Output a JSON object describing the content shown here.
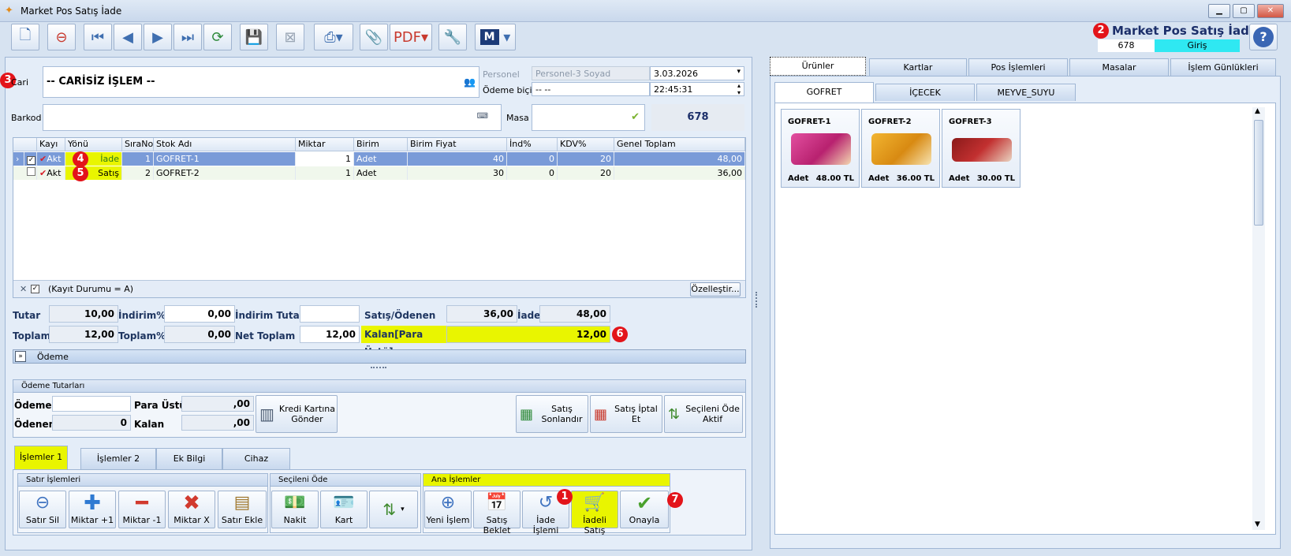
{
  "window": {
    "title": "Market Pos Satış İade"
  },
  "header": {
    "title": "Market Pos Satış İade",
    "number": "678",
    "mode": "Giriş"
  },
  "form": {
    "cari_label": "Cari",
    "cari_value": "-- CARİSİZ İŞLEM --",
    "personel_label": "Personel",
    "personel_value": "Personel-3 Soyad",
    "odeme_label": "Ödeme biçimi",
    "odeme_value": "-- --",
    "date": "3.03.2026",
    "time": "22:45:31",
    "barkod_label": "Barkod",
    "masa_label": "Masa",
    "masa_no": "678"
  },
  "grid": {
    "columns": [
      "Kayı",
      "Yönü",
      "SıraNo",
      "Stok Adı",
      "Miktar",
      "Birim",
      "Birim Fiyat",
      "İnd%",
      "KDV%",
      "Genel Toplam"
    ],
    "rows": [
      {
        "kayit": "Akt",
        "yonu": "İade",
        "sira": "1",
        "stok": "GOFRET-1",
        "miktar": "1",
        "birim": "Adet",
        "fiyat": "40",
        "ind": "0",
        "kdv": "20",
        "toplam": "48,00"
      },
      {
        "kayit": "Akt",
        "yonu": "Satış",
        "sira": "2",
        "stok": "GOFRET-2",
        "miktar": "1",
        "birim": "Adet",
        "fiyat": "30",
        "ind": "0",
        "kdv": "20",
        "toplam": "36,00"
      }
    ],
    "filter": "(Kayıt Durumu = A)",
    "customize": "Özelleştir..."
  },
  "totals": {
    "tutar_label": "Tutar",
    "tutar": "10,00",
    "toplam_label": "Toplam",
    "toplam": "12,00",
    "indirim_label": "İndirim%",
    "indirim": "0,00",
    "toplam_pct_label": "Toplam%",
    "toplam_pct": "0,00",
    "indirim_tutar_label": "İndirim Tutar",
    "indirim_tutar": "",
    "net_label": "Net Toplam",
    "net": "12,00",
    "satis_label": "Satış/Ödenen",
    "satis": "36,00",
    "iade_label": "İade",
    "iade": "48,00",
    "kalan_label": "Kalan[Para Üstü]",
    "kalan": "12,00"
  },
  "odeme_bar": "Ödeme",
  "odeme_tutarlari": {
    "title": "Ödeme Tutarları",
    "odeme_label": "Ödeme",
    "odeme": "",
    "odenen_label": "Ödenen",
    "odenen": "0",
    "para_ustu_label": "Para Üstü",
    "para_ustu": ",00",
    "kalan_label": "Kalan",
    "kalan": ",00",
    "kredi": "Kredi Kartına Gönder",
    "satis_sonlandir": "Satış Sonlandır",
    "satis_iptal": "Satış İptal Et",
    "secileni_ode": "Seçileni Öde Aktif"
  },
  "bottom_tabs": [
    "İşlemler 1",
    "İşlemler 2",
    "Ek Bilgi",
    "Cihaz"
  ],
  "groups": {
    "satir": {
      "title": "Satır İşlemleri",
      "buttons": [
        "Satır Sil",
        "Miktar +1",
        "Miktar -1",
        "Miktar X",
        "Satır Ekle"
      ]
    },
    "secileni": {
      "title": "Seçileni Öde",
      "buttons": [
        "Nakit",
        "Kart"
      ]
    },
    "ana": {
      "title": "Ana İşlemler",
      "buttons": [
        "Yeni İşlem",
        "Satış Beklet",
        "İade İşlemi",
        "İadeli Satış",
        "Onayla"
      ]
    }
  },
  "right_tabs": [
    "Ürünler",
    "Kartlar",
    "Pos İşlemleri",
    "Masalar",
    "İşlem Günlükleri"
  ],
  "category_tabs": [
    "GOFRET",
    "İÇECEK",
    "MEYVE_SUYU"
  ],
  "products": [
    {
      "name": "GOFRET-1",
      "unit": "Adet",
      "price": "48.00 TL"
    },
    {
      "name": "GOFRET-2",
      "unit": "Adet",
      "price": "36.00 TL"
    },
    {
      "name": "GOFRET-3",
      "unit": "Adet",
      "price": "30.00 TL"
    }
  ],
  "badges": [
    "1",
    "2",
    "3",
    "4",
    "5",
    "6",
    "7"
  ],
  "colors": {
    "highlight": "#e9f500",
    "accent": "#3f73c0",
    "badge": "#e3141a"
  }
}
